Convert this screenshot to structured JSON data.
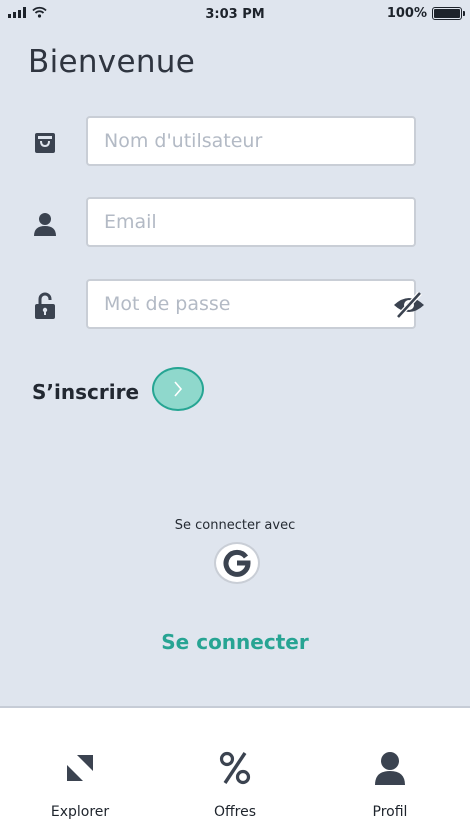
{
  "status_bar": {
    "time": "3:03 PM",
    "battery": "100%"
  },
  "page": {
    "title": "Bienvenue"
  },
  "form": {
    "username": {
      "placeholder": "Nom d'utilsateur",
      "value": "",
      "icon": "bag-icon"
    },
    "email": {
      "placeholder": "Email",
      "value": "",
      "icon": "user-icon"
    },
    "password": {
      "placeholder": "Mot de passe",
      "value": "",
      "icon": "unlock-icon",
      "toggle_icon": "eye-off-icon"
    }
  },
  "signup": {
    "label": "S’inscrire",
    "button_icon": "chevron-right-icon"
  },
  "social": {
    "label": "Se connecter avec",
    "provider": "google-icon"
  },
  "login": {
    "label": "Se connecter"
  },
  "tabs": [
    {
      "label": "Explorer",
      "icon": "explore-icon"
    },
    {
      "label": "Offres",
      "icon": "percent-icon"
    },
    {
      "label": "Profil",
      "icon": "profile-icon"
    }
  ],
  "colors": {
    "background": "#dfe5ee",
    "accent": "#27a493",
    "accent_light": "#8fd8cc",
    "text_dark": "#2c3440",
    "icon": "#3b4350"
  }
}
